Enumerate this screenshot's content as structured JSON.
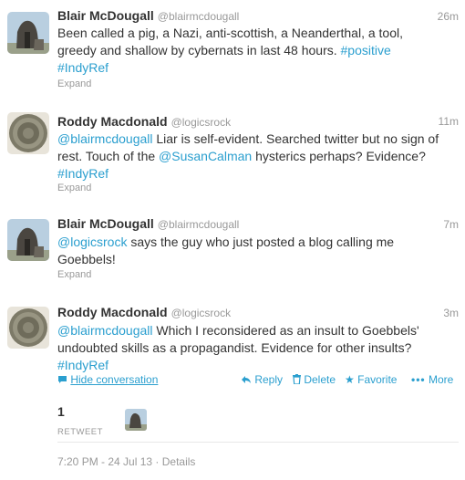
{
  "tweets": [
    {
      "name": "Blair McDougall",
      "handle": "@blairmcdougall",
      "time": "26m",
      "text_line1": "Been called a pig, a Nazi, anti-scottish, a Neanderthal, a tool,",
      "text_line2": "greedy and shallow by cybernats in last 48 hours.",
      "tag1": "#positive",
      "tag2": "#IndyRef",
      "expand": "Expand"
    },
    {
      "name": "Roddy Macdonald",
      "handle": "@logicsrock",
      "time": "11m",
      "mention1": "@blairmcdougall",
      "text_a": "Liar is self-evident. Searched twitter but no sign of",
      "text_b": "rest. Touch of the",
      "mention2": "@SusanCalman",
      "text_c": "hysterics perhaps? Evidence?",
      "tag": "#IndyRef",
      "expand": "Expand"
    },
    {
      "name": "Blair McDougall",
      "handle": "@blairmcdougall",
      "time": "7m",
      "mention": "@logicsrock",
      "text_a": "says the guy who just posted a blog calling me",
      "text_b": "Goebbels!",
      "expand": "Expand"
    },
    {
      "name": "Roddy Macdonald",
      "handle": "@logicsrock",
      "time": "3m",
      "mention": "@blairmcdougall",
      "text_a": "Which I reconsidered as an insult to Goebbels'",
      "text_b": "undoubted skills as a propagandist. Evidence for other insults?",
      "tag": "#IndyRef",
      "hide_conversation": "Hide conversation",
      "reply": "Reply",
      "delete": "Delete",
      "favorite": "Favorite",
      "more": "More",
      "retweet_count": "1",
      "retweet_label": "RETWEET",
      "timestamp": "7:20 PM - 24 Jul 13",
      "separator": "·",
      "details": "Details"
    }
  ],
  "colors": {
    "link": "#2b9fcf",
    "muted": "#999999",
    "text": "#333333",
    "border": "#e6e6e6"
  }
}
